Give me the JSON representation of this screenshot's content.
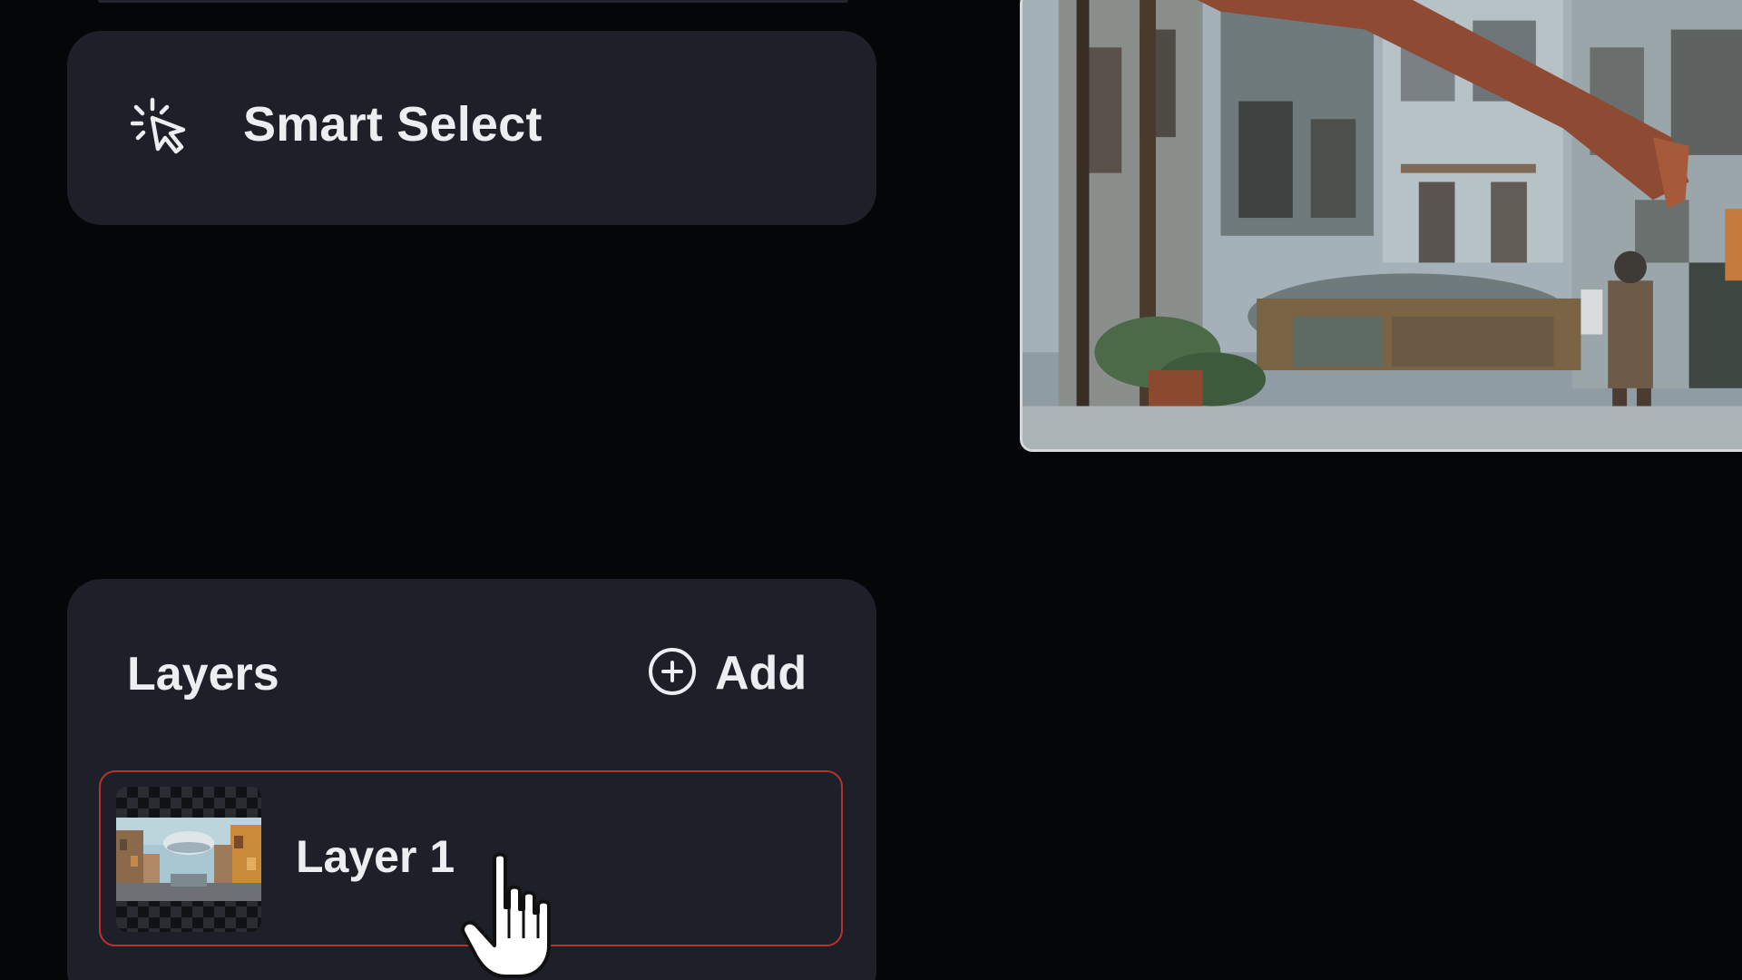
{
  "tools": {
    "smart_select": {
      "label": "Smart Select",
      "icon": "sparkle-cursor-icon"
    }
  },
  "layers": {
    "title": "Layers",
    "add_label": "Add",
    "add_icon": "plus-circle-icon",
    "items": [
      {
        "label": "Layer 1",
        "selected": true
      }
    ]
  },
  "canvas": {
    "image": "city-street-illustration"
  },
  "colors": {
    "panel": "#1e2029",
    "background": "#050608",
    "selected_border": "#b8322b",
    "text": "#eceef2"
  },
  "cursor": {
    "type": "pointer-hand-icon"
  }
}
